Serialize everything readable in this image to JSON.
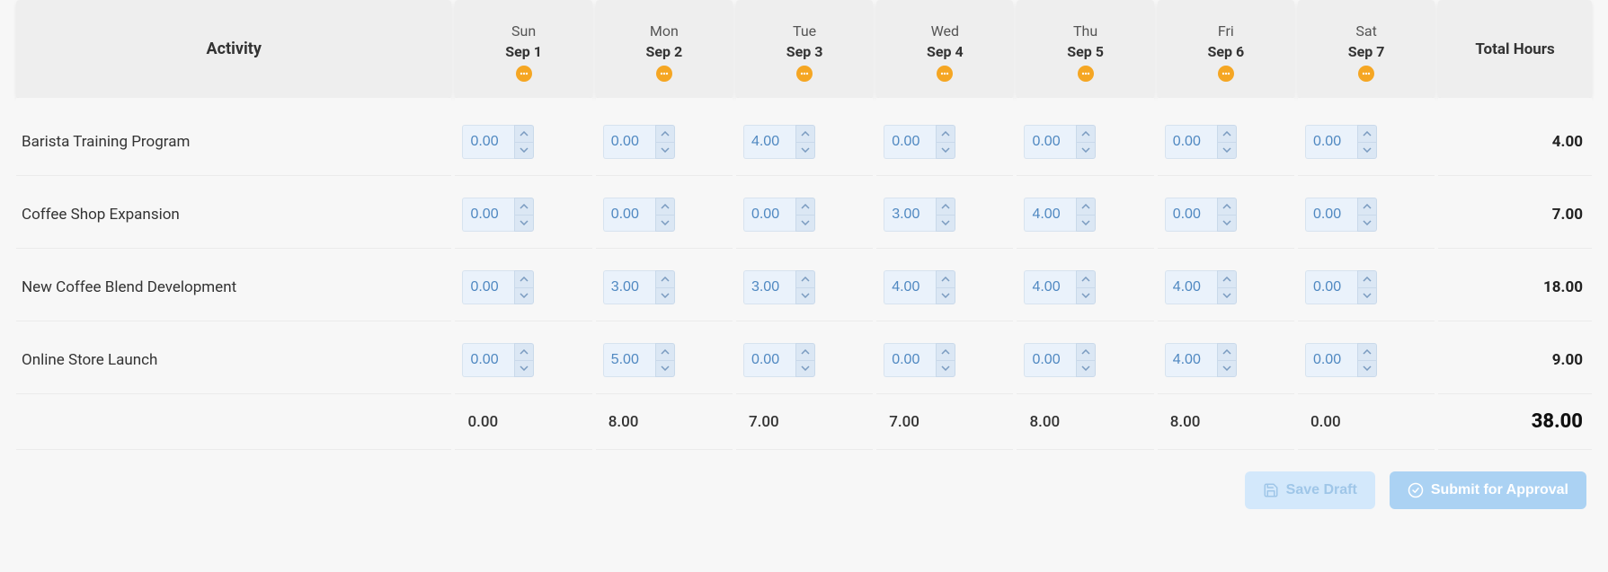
{
  "header": {
    "activity_label": "Activity",
    "total_label": "Total Hours",
    "days": [
      {
        "dow": "Sun",
        "date": "Sep 1"
      },
      {
        "dow": "Mon",
        "date": "Sep 2"
      },
      {
        "dow": "Tue",
        "date": "Sep 3"
      },
      {
        "dow": "Wed",
        "date": "Sep 4"
      },
      {
        "dow": "Thu",
        "date": "Sep 5"
      },
      {
        "dow": "Fri",
        "date": "Sep 6"
      },
      {
        "dow": "Sat",
        "date": "Sep 7"
      }
    ]
  },
  "rows": [
    {
      "activity": "Barista Training Program",
      "values": [
        "0.00",
        "0.00",
        "4.00",
        "0.00",
        "0.00",
        "0.00",
        "0.00"
      ],
      "total": "4.00"
    },
    {
      "activity": "Coffee Shop Expansion",
      "values": [
        "0.00",
        "0.00",
        "0.00",
        "3.00",
        "4.00",
        "0.00",
        "0.00"
      ],
      "total": "7.00"
    },
    {
      "activity": "New Coffee Blend Development",
      "values": [
        "0.00",
        "3.00",
        "3.00",
        "4.00",
        "4.00",
        "4.00",
        "0.00"
      ],
      "total": "18.00"
    },
    {
      "activity": "Online Store Launch",
      "values": [
        "0.00",
        "5.00",
        "0.00",
        "0.00",
        "0.00",
        "4.00",
        "0.00"
      ],
      "total": "9.00"
    }
  ],
  "footer": {
    "day_totals": [
      "0.00",
      "8.00",
      "7.00",
      "7.00",
      "8.00",
      "8.00",
      "0.00"
    ],
    "grand_total": "38.00"
  },
  "actions": {
    "save_label": "Save Draft",
    "submit_label": "Submit for Approval"
  }
}
